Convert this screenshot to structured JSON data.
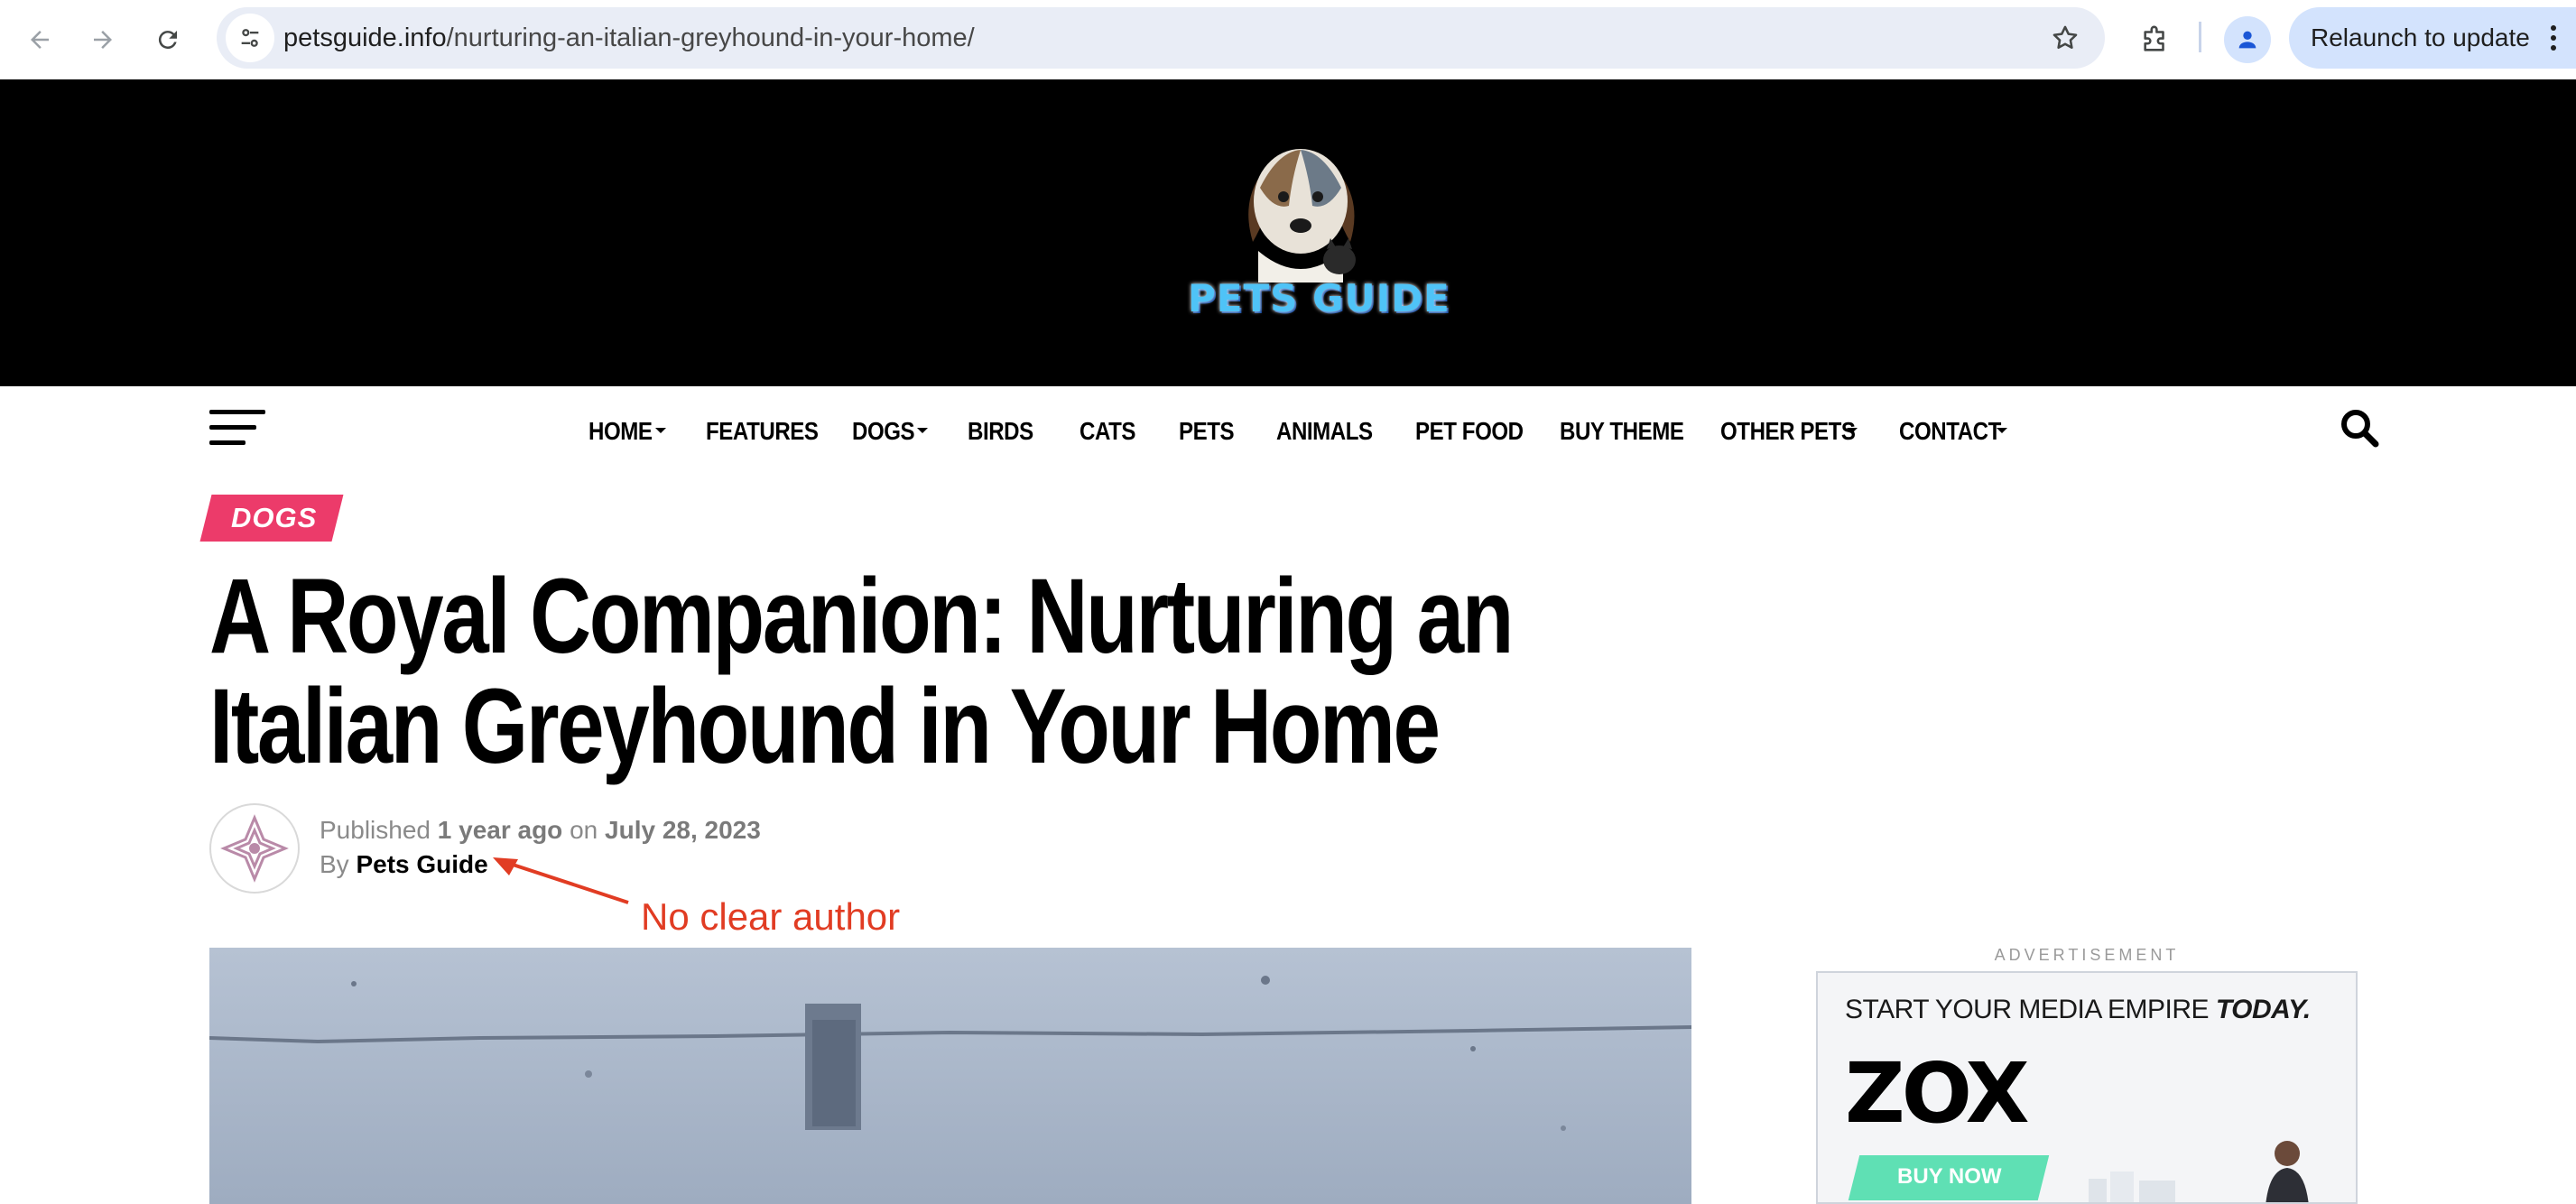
{
  "browser": {
    "url_domain": "petsguide.info",
    "url_path": "/nurturing-an-italian-greyhound-in-your-home/",
    "relaunch_label": "Relaunch to update"
  },
  "site": {
    "logo_text": "PETS GUIDE"
  },
  "nav": {
    "items": [
      {
        "label": "HOME",
        "has_dropdown": true
      },
      {
        "label": "FEATURES",
        "has_dropdown": false
      },
      {
        "label": "DOGS",
        "has_dropdown": true
      },
      {
        "label": "BIRDS",
        "has_dropdown": false
      },
      {
        "label": "CATS",
        "has_dropdown": false
      },
      {
        "label": "PETS",
        "has_dropdown": false
      },
      {
        "label": "ANIMALS",
        "has_dropdown": false
      },
      {
        "label": "PET FOOD",
        "has_dropdown": false
      },
      {
        "label": "BUY THEME",
        "has_dropdown": false
      },
      {
        "label": "OTHER PETS",
        "has_dropdown": true
      },
      {
        "label": "CONTACT",
        "has_dropdown": true
      }
    ]
  },
  "article": {
    "category": "DOGS",
    "title": "A Royal Companion: Nurturing an Italian Greyhound in Your Home",
    "published_prefix": "Published",
    "published_ago": "1 year ago",
    "published_on": "on",
    "published_date": "July 28, 2023",
    "by_prefix": "By",
    "author": "Pets Guide"
  },
  "annotation": {
    "text": "No clear author",
    "color": "#e13c23"
  },
  "sidebar": {
    "ad_label": "ADVERTISEMENT",
    "ad_headline_normal": "START YOUR MEDIA EMPIRE",
    "ad_headline_bold": "TODAY.",
    "ad_brand": "ZOX",
    "ad_button": "BUY NOW"
  },
  "colors": {
    "header_bg": "#000000",
    "category_badge": "#ec3b6a",
    "ad_button": "#5fe0b4"
  }
}
